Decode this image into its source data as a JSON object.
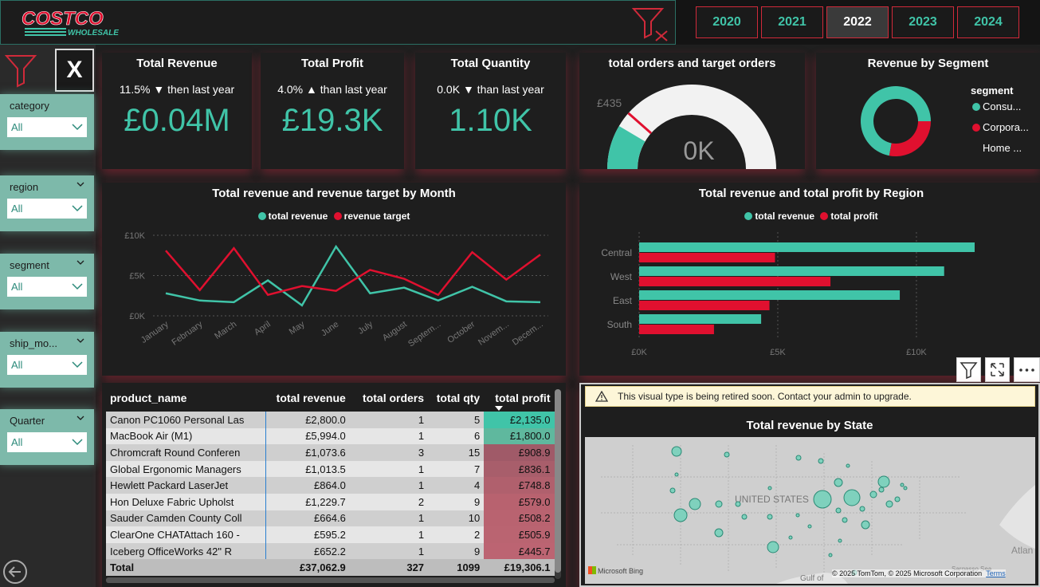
{
  "brand": {
    "name": "COSTCO",
    "sub": "WHOLESALE"
  },
  "years": [
    {
      "label": "2020",
      "selected": false
    },
    {
      "label": "2021",
      "selected": false
    },
    {
      "label": "2022",
      "selected": true
    },
    {
      "label": "2023",
      "selected": false
    },
    {
      "label": "2024",
      "selected": false
    }
  ],
  "clear_label": "X",
  "slicers": [
    {
      "label": "category",
      "value": "All"
    },
    {
      "label": "region",
      "value": "All"
    },
    {
      "label": "segment",
      "value": "All"
    },
    {
      "label": "ship_mo...",
      "value": "All"
    },
    {
      "label": "Quarter",
      "value": "All"
    }
  ],
  "kpis": {
    "revenue": {
      "title": "Total Revenue",
      "sub": "11.5% ▼ then last year",
      "value": "£0.04M"
    },
    "profit": {
      "title": "Total Profit",
      "sub": "4.0% ▲ than last year",
      "value": "£19.3K"
    },
    "quantity": {
      "title": "Total Quantity",
      "sub": "0.0K ▼ than last year",
      "value": "1.10K"
    }
  },
  "gauge": {
    "title": "total orders and target orders",
    "target_label": "£435",
    "value_label": "0K",
    "fill_fraction": 0.17,
    "target_fraction": 0.23
  },
  "segment_donut": {
    "title": "Revenue by Segment",
    "legend_title": "segment",
    "items": [
      {
        "label": "Consu...",
        "color": "#40c4a8",
        "share": 0.72
      },
      {
        "label": "Corpora...",
        "color": "#e0102f",
        "share": 0.28
      },
      {
        "label": "Home ...",
        "color": "",
        "share": 0
      }
    ]
  },
  "chart_data": [
    {
      "type": "line",
      "title": "Total revenue and revenue target by Month",
      "categories": [
        "January",
        "February",
        "March",
        "April",
        "May",
        "June",
        "July",
        "August",
        "Septem...",
        "October",
        "Novem...",
        "Decem..."
      ],
      "ylim": [
        0,
        10000
      ],
      "yticks": [
        "£0K",
        "£5K",
        "£10K"
      ],
      "series": [
        {
          "name": "total revenue",
          "color": "#40c4a8",
          "values": [
            2800,
            1900,
            1700,
            4400,
            1300,
            8600,
            2800,
            3500,
            1900,
            3600,
            1800,
            1700
          ]
        },
        {
          "name": "revenue target",
          "color": "#e0102f",
          "values": [
            8100,
            3200,
            8400,
            2600,
            3700,
            3100,
            5700,
            4600,
            2600,
            7900,
            4500,
            7600
          ]
        }
      ]
    },
    {
      "type": "bar",
      "title": "Total revenue and total profit by Region",
      "categories": [
        "Central",
        "West",
        "East",
        "South"
      ],
      "xlim": [
        0,
        13000
      ],
      "xticks": [
        "£0K",
        "£5K",
        "£10K"
      ],
      "series": [
        {
          "name": "total revenue",
          "color": "#40c4a8",
          "values": [
            12100,
            11000,
            9400,
            4400
          ]
        },
        {
          "name": "total profit",
          "color": "#e0102f",
          "values": [
            4900,
            6900,
            4700,
            2700
          ]
        }
      ]
    }
  ],
  "table": {
    "columns": [
      "product_name",
      "total revenue",
      "total orders",
      "total qty",
      "total profit"
    ],
    "rows": [
      [
        "Canon PC1060 Personal Las",
        "£2,800.0",
        "1",
        "5",
        "£2,135.0"
      ],
      [
        "MacBook Air (M1)",
        "£5,994.0",
        "1",
        "6",
        "£1,800.0"
      ],
      [
        "Chromcraft Round Conferen",
        "£1,073.6",
        "3",
        "15",
        "£908.9"
      ],
      [
        "Global Ergonomic Managers",
        "£1,013.5",
        "1",
        "7",
        "£836.1"
      ],
      [
        "Hewlett Packard LaserJet",
        "£864.0",
        "1",
        "4",
        "£748.8"
      ],
      [
        "Hon Deluxe Fabric Upholst",
        "£1,229.7",
        "2",
        "9",
        "£579.0"
      ],
      [
        "Sauder Camden County Coll",
        "£664.6",
        "1",
        "10",
        "£508.2"
      ],
      [
        "ClearOne CHATAttach 160 -",
        "£595.2",
        "1",
        "2",
        "£505.9"
      ],
      [
        "Iceberg OfficeWorks 42\" R",
        "£652.2",
        "1",
        "9",
        "£445.7"
      ]
    ],
    "total": [
      "Total",
      "£37,062.9",
      "327",
      "1099",
      "£19,306.1"
    ],
    "profit_colors": [
      "#40c4a8",
      "#5fb89e",
      "#a05a68",
      "#a85e6b",
      "#b0606d",
      "#b8626f",
      "#b96370",
      "#ba6471",
      "#bc6472"
    ]
  },
  "map": {
    "warning": "This visual type is being retired soon. Contact your admin to upgrade.",
    "title": "Total revenue by State",
    "country_label": "UNITED STATES",
    "sea_label": "Sargasso Sea",
    "ocean_label": "Atlan",
    "gulf_label": "Gulf of",
    "attribution": "© 2025 TomTom, © 2025 Microsoft Corporation",
    "terms": "Terms",
    "bing": "Microsoft Bing"
  }
}
